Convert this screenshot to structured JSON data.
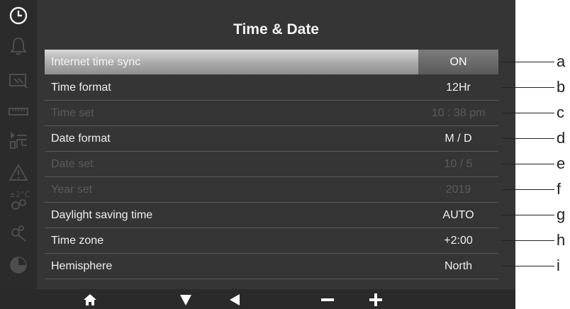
{
  "title": "Time & Date",
  "rows": [
    {
      "label": "Internet time sync",
      "value": "ON",
      "state": "selected",
      "callout": "a"
    },
    {
      "label": "Time format",
      "value": "12Hr",
      "state": "normal",
      "callout": "b"
    },
    {
      "label": "Time set",
      "value": "10 : 38 pm",
      "state": "disabled",
      "callout": "c"
    },
    {
      "label": "Date format",
      "value": "M / D",
      "state": "normal",
      "callout": "d"
    },
    {
      "label": "Date set",
      "value": "10 / 5",
      "state": "disabled",
      "callout": "e"
    },
    {
      "label": "Year set",
      "value": "2019",
      "state": "disabled",
      "callout": "f"
    },
    {
      "label": "Daylight saving time",
      "value": "AUTO",
      "state": "normal",
      "callout": "g"
    },
    {
      "label": "Time zone",
      "value": "+2:00",
      "state": "normal",
      "callout": "h"
    },
    {
      "label": "Hemisphere",
      "value": "North",
      "state": "normal",
      "callout": "i"
    }
  ],
  "sidebar": {
    "items": [
      {
        "icon": "clock-icon",
        "active": true
      },
      {
        "icon": "bell-icon",
        "active": false
      },
      {
        "icon": "display-settings-icon",
        "active": false
      },
      {
        "icon": "ruler-icon",
        "active": false
      },
      {
        "icon": "sensor-settings-icon",
        "active": false
      },
      {
        "icon": "warning-icon",
        "active": false
      },
      {
        "icon": "temperature-offset-icon",
        "active": false
      },
      {
        "icon": "tools-icon",
        "active": false
      },
      {
        "icon": "pie-chart-icon",
        "active": false
      }
    ],
    "sidebar_temp_label": "±2°C"
  },
  "bottombar": {
    "buttons": [
      {
        "icon": "home-icon"
      },
      {
        "icon": "down-arrow-icon"
      },
      {
        "icon": "left-arrow-icon"
      },
      {
        "icon": "minus-icon"
      },
      {
        "icon": "plus-icon"
      }
    ]
  },
  "colors": {
    "screen_bg": "#353535",
    "sidebar_bg": "#2b2b2b",
    "text": "#f0f0f0",
    "disabled_text": "#5b5b5b",
    "selected_highlight": "#a9a9a9"
  }
}
